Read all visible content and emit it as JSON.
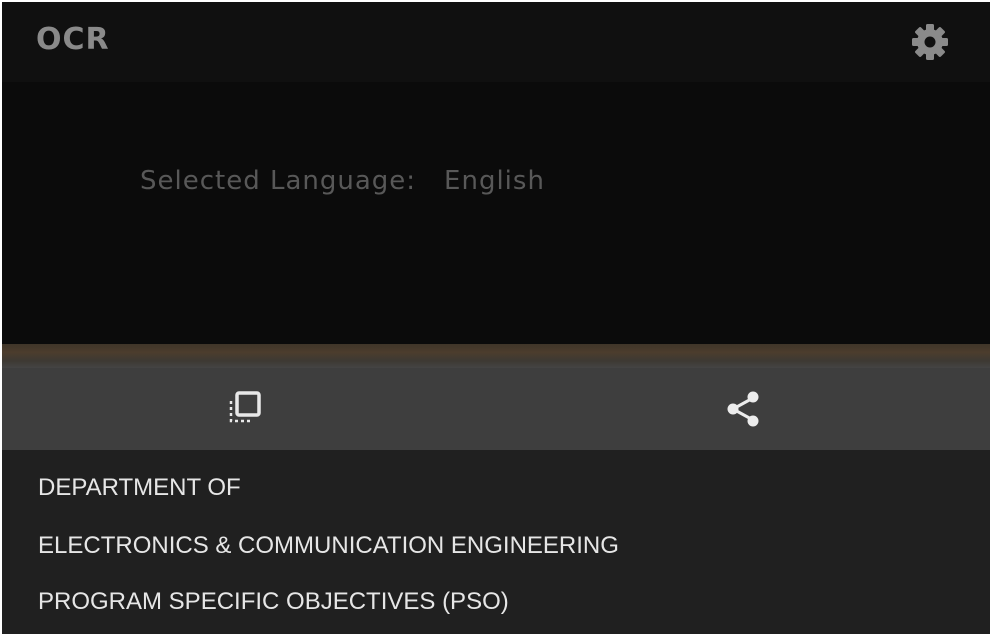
{
  "appbar": {
    "title": "OCR",
    "settings_icon": "gear-icon"
  },
  "preview": {
    "language_label": "Selected Language:",
    "language_value": "English"
  },
  "actions": {
    "copy_icon": "copy-icon",
    "share_icon": "share-icon"
  },
  "result": {
    "lines": [
      "DEPARTMENT OF",
      "ELECTRONICS & COMMUNICATION ENGINEERING",
      "PROGRAM SPECIFIC OBJECTIVES (PSO)"
    ]
  },
  "colors": {
    "background": "#0d0d0d",
    "action_bar": "#3e3e3e",
    "result_panel": "#202020",
    "text": "#e6e6e6"
  }
}
